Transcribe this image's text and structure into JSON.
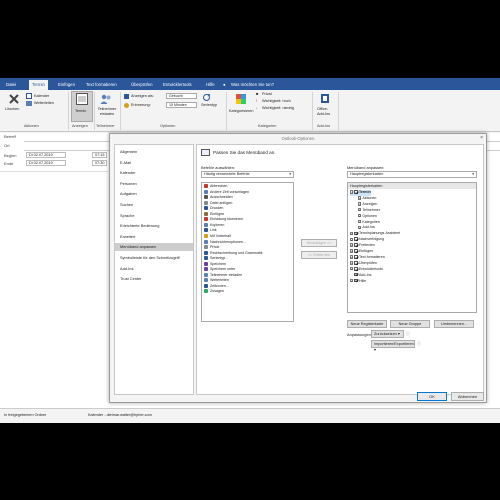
{
  "ribbon_tabs": [
    "Datei",
    "Termin",
    "Einfügen",
    "Text formatieren",
    "Überprüfen",
    "Entwicklertools",
    "Hilfe"
  ],
  "tell_me": "Was möchten Sie tun?",
  "ribbon": {
    "aktionen": {
      "delete": "Löschen",
      "calendar": "Kalender",
      "forward": "Weiterleiten",
      "label": "Aktionen"
    },
    "anzeigen": {
      "termin": "Termin",
      "label": "Anzeigen"
    },
    "teilnehmer": {
      "invite": "Teilnehmer einladen",
      "label": "Teilnehmer"
    },
    "optionen": {
      "show_as_label": "Anzeigen als:",
      "show_as_value": "Gebucht",
      "reminder_label": "Erinnerung:",
      "reminder_value": "15 Minuten",
      "series": "Serientyp",
      "label": "Optionen"
    },
    "kategorien": {
      "categorize": "Kategorisieren",
      "private": "Privat",
      "high": "Wichtigkeit: hoch",
      "low": "Wichtigkeit: niedrig",
      "label": "Kategorien"
    },
    "addins": {
      "office": "Office-Add-Ins",
      "label": "Add-Ins"
    }
  },
  "form": {
    "subject_label": "Betreff",
    "location_label": "Ort",
    "start_label": "Beginn",
    "end_label": "Ende",
    "start_date": "Di 02.07.2019",
    "start_time": "07:15",
    "end_date": "Di 02.07.2019",
    "end_time": "07:30"
  },
  "statusbar": {
    "folder": "In freigegebenem Ordner",
    "calendar": "Kalender - dietmar.walter@hpher.com"
  },
  "dialog": {
    "title": "Outlook-Optionen",
    "nav": [
      "Allgemein",
      "E-Mail",
      "Kalender",
      "Personen",
      "Aufgaben",
      "Suchen",
      "Sprache",
      "Erleichterte Bedienung",
      "Erweitert",
      "Menüband anpassen",
      "Symbolleiste für den Schnellzugriff",
      "Add-Ins",
      "Trust Center"
    ],
    "nav_selected": 9,
    "header": "Passen Sie das Menüband an.",
    "choose_label": "Befehle auswählen:",
    "choose_value": "Häufig verwendete Befehle",
    "customize_label": "Menüband anpassen:",
    "customize_value": "Hauptregisterkarten",
    "commands": [
      "Abbrechen",
      "Andere Zeit vorschlagen",
      "Ausschneiden",
      "Datei anfügen",
      "Drucken",
      "Einfügen",
      "Einladung stornieren",
      "Kopieren",
      "Link",
      "Mit Vorbehalt",
      "Nachrichtenoptionen...",
      "Privat",
      "Rechtschreibung und Grammatik",
      "Serientyp...",
      "Speichern",
      "Speichern unter",
      "Teilnehmer einladen",
      "Weiterleiten",
      "Zeitzonen...",
      "Zusagen"
    ],
    "add_button": "Hinzufügen >>",
    "remove_button": "<< Entfernen",
    "tree_header": "Hauptregisterkarten",
    "tree": [
      {
        "label": "Termin",
        "level": 0,
        "expander": "-",
        "checked": true,
        "bold": true
      },
      {
        "label": "Aktionen",
        "level": 1,
        "expander": "+",
        "checked": false
      },
      {
        "label": "Anzeigen",
        "level": 1,
        "expander": "+",
        "checked": false
      },
      {
        "label": "Teilnehmer",
        "level": 1,
        "expander": "+",
        "checked": false
      },
      {
        "label": "Optionen",
        "level": 1,
        "expander": "+",
        "checked": false
      },
      {
        "label": "Kategorien",
        "level": 1,
        "expander": "+",
        "checked": false
      },
      {
        "label": "Add-Ins",
        "level": 1,
        "expander": "+",
        "checked": false
      },
      {
        "label": "Terminplanungs-Assistent",
        "level": 0,
        "expander": "+",
        "checked": true
      },
      {
        "label": "Nachverfolgung",
        "level": 0,
        "expander": "+",
        "checked": true
      },
      {
        "label": "Freitexten",
        "level": 0,
        "expander": "+",
        "checked": true
      },
      {
        "label": "Einfügen",
        "level": 0,
        "expander": "+",
        "checked": true
      },
      {
        "label": "Text formatieren",
        "level": 0,
        "expander": "+",
        "checked": true
      },
      {
        "label": "Überprüfen",
        "level": 0,
        "expander": "+",
        "checked": true
      },
      {
        "label": "Entwicklertools",
        "level": 0,
        "expander": "+",
        "checked": true
      },
      {
        "label": "Add-Ins",
        "level": 0,
        "expander": "",
        "checked": true
      },
      {
        "label": "Hilfe",
        "level": 0,
        "expander": "+",
        "checked": true
      }
    ],
    "new_tab": "Neue Registerkarte",
    "new_group": "Neue Gruppe",
    "rename": "Umbenennen...",
    "customizations_label": "Anpassungen:",
    "reset": "Zurücksetzen",
    "import_export": "Importieren/Exportieren",
    "ok": "OK",
    "cancel": "Abbrechen"
  }
}
